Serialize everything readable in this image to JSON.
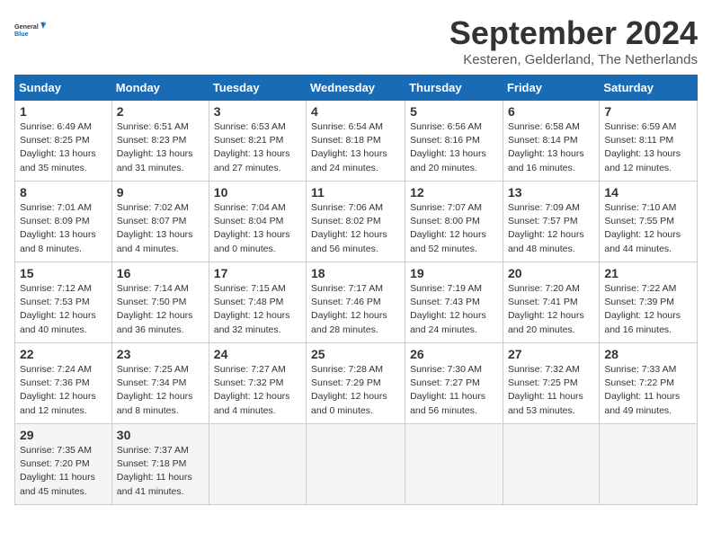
{
  "header": {
    "logo_line1": "General",
    "logo_line2": "Blue",
    "month": "September 2024",
    "location": "Kesteren, Gelderland, The Netherlands"
  },
  "columns": [
    "Sunday",
    "Monday",
    "Tuesday",
    "Wednesday",
    "Thursday",
    "Friday",
    "Saturday"
  ],
  "weeks": [
    [
      {
        "day": "1",
        "info": "Sunrise: 6:49 AM\nSunset: 8:25 PM\nDaylight: 13 hours\nand 35 minutes."
      },
      {
        "day": "2",
        "info": "Sunrise: 6:51 AM\nSunset: 8:23 PM\nDaylight: 13 hours\nand 31 minutes."
      },
      {
        "day": "3",
        "info": "Sunrise: 6:53 AM\nSunset: 8:21 PM\nDaylight: 13 hours\nand 27 minutes."
      },
      {
        "day": "4",
        "info": "Sunrise: 6:54 AM\nSunset: 8:18 PM\nDaylight: 13 hours\nand 24 minutes."
      },
      {
        "day": "5",
        "info": "Sunrise: 6:56 AM\nSunset: 8:16 PM\nDaylight: 13 hours\nand 20 minutes."
      },
      {
        "day": "6",
        "info": "Sunrise: 6:58 AM\nSunset: 8:14 PM\nDaylight: 13 hours\nand 16 minutes."
      },
      {
        "day": "7",
        "info": "Sunrise: 6:59 AM\nSunset: 8:11 PM\nDaylight: 13 hours\nand 12 minutes."
      }
    ],
    [
      {
        "day": "8",
        "info": "Sunrise: 7:01 AM\nSunset: 8:09 PM\nDaylight: 13 hours\nand 8 minutes."
      },
      {
        "day": "9",
        "info": "Sunrise: 7:02 AM\nSunset: 8:07 PM\nDaylight: 13 hours\nand 4 minutes."
      },
      {
        "day": "10",
        "info": "Sunrise: 7:04 AM\nSunset: 8:04 PM\nDaylight: 13 hours\nand 0 minutes."
      },
      {
        "day": "11",
        "info": "Sunrise: 7:06 AM\nSunset: 8:02 PM\nDaylight: 12 hours\nand 56 minutes."
      },
      {
        "day": "12",
        "info": "Sunrise: 7:07 AM\nSunset: 8:00 PM\nDaylight: 12 hours\nand 52 minutes."
      },
      {
        "day": "13",
        "info": "Sunrise: 7:09 AM\nSunset: 7:57 PM\nDaylight: 12 hours\nand 48 minutes."
      },
      {
        "day": "14",
        "info": "Sunrise: 7:10 AM\nSunset: 7:55 PM\nDaylight: 12 hours\nand 44 minutes."
      }
    ],
    [
      {
        "day": "15",
        "info": "Sunrise: 7:12 AM\nSunset: 7:53 PM\nDaylight: 12 hours\nand 40 minutes."
      },
      {
        "day": "16",
        "info": "Sunrise: 7:14 AM\nSunset: 7:50 PM\nDaylight: 12 hours\nand 36 minutes."
      },
      {
        "day": "17",
        "info": "Sunrise: 7:15 AM\nSunset: 7:48 PM\nDaylight: 12 hours\nand 32 minutes."
      },
      {
        "day": "18",
        "info": "Sunrise: 7:17 AM\nSunset: 7:46 PM\nDaylight: 12 hours\nand 28 minutes."
      },
      {
        "day": "19",
        "info": "Sunrise: 7:19 AM\nSunset: 7:43 PM\nDaylight: 12 hours\nand 24 minutes."
      },
      {
        "day": "20",
        "info": "Sunrise: 7:20 AM\nSunset: 7:41 PM\nDaylight: 12 hours\nand 20 minutes."
      },
      {
        "day": "21",
        "info": "Sunrise: 7:22 AM\nSunset: 7:39 PM\nDaylight: 12 hours\nand 16 minutes."
      }
    ],
    [
      {
        "day": "22",
        "info": "Sunrise: 7:24 AM\nSunset: 7:36 PM\nDaylight: 12 hours\nand 12 minutes."
      },
      {
        "day": "23",
        "info": "Sunrise: 7:25 AM\nSunset: 7:34 PM\nDaylight: 12 hours\nand 8 minutes."
      },
      {
        "day": "24",
        "info": "Sunrise: 7:27 AM\nSunset: 7:32 PM\nDaylight: 12 hours\nand 4 minutes."
      },
      {
        "day": "25",
        "info": "Sunrise: 7:28 AM\nSunset: 7:29 PM\nDaylight: 12 hours\nand 0 minutes."
      },
      {
        "day": "26",
        "info": "Sunrise: 7:30 AM\nSunset: 7:27 PM\nDaylight: 11 hours\nand 56 minutes."
      },
      {
        "day": "27",
        "info": "Sunrise: 7:32 AM\nSunset: 7:25 PM\nDaylight: 11 hours\nand 53 minutes."
      },
      {
        "day": "28",
        "info": "Sunrise: 7:33 AM\nSunset: 7:22 PM\nDaylight: 11 hours\nand 49 minutes."
      }
    ],
    [
      {
        "day": "29",
        "info": "Sunrise: 7:35 AM\nSunset: 7:20 PM\nDaylight: 11 hours\nand 45 minutes."
      },
      {
        "day": "30",
        "info": "Sunrise: 7:37 AM\nSunset: 7:18 PM\nDaylight: 11 hours\nand 41 minutes."
      },
      {
        "day": "",
        "info": ""
      },
      {
        "day": "",
        "info": ""
      },
      {
        "day": "",
        "info": ""
      },
      {
        "day": "",
        "info": ""
      },
      {
        "day": "",
        "info": ""
      }
    ]
  ]
}
